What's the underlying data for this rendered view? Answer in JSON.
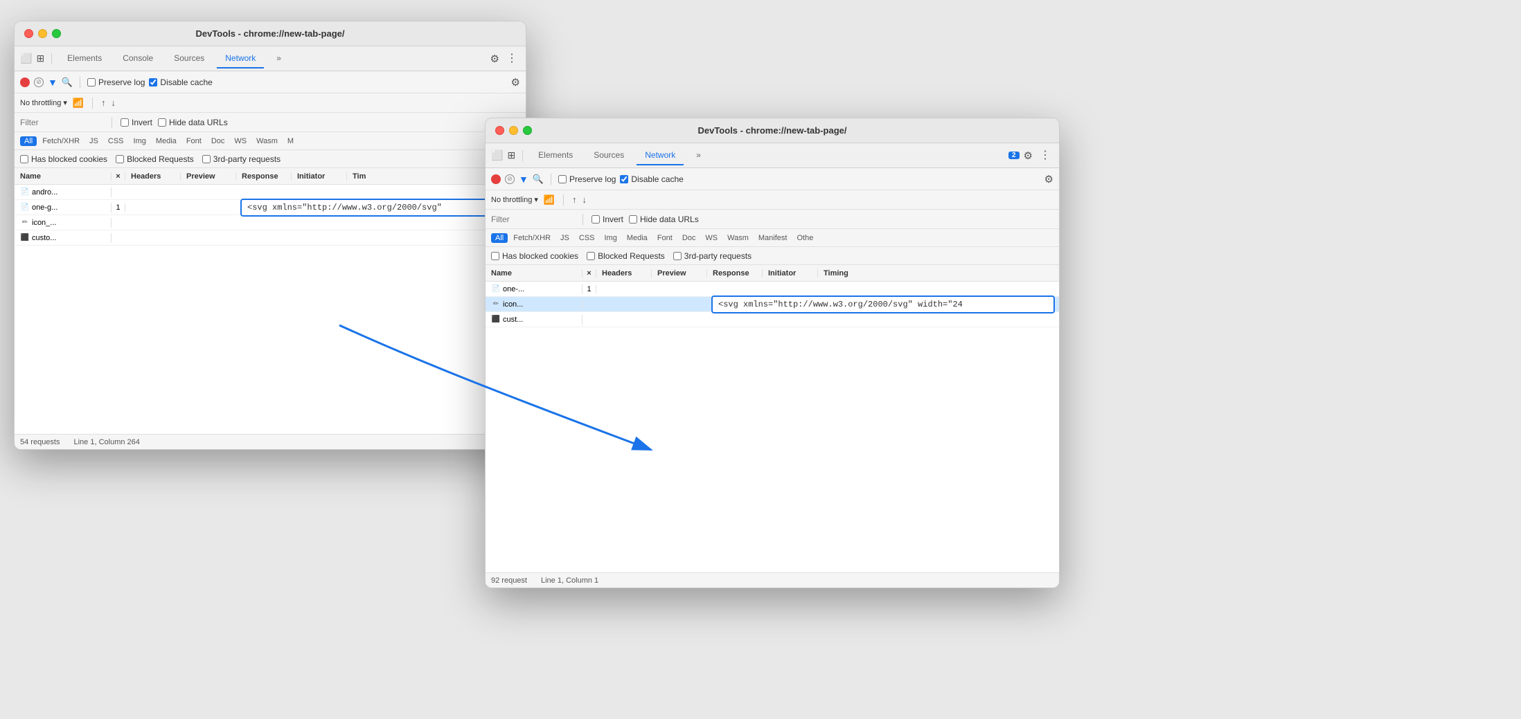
{
  "window1": {
    "title": "DevTools - chrome://new-tab-page/",
    "tabs": [
      "Elements",
      "Console",
      "Sources",
      "Network",
      "»"
    ],
    "active_tab": "Network",
    "network_controls": {
      "preserve_log": "Preserve log",
      "disable_cache": "Disable cache"
    },
    "throttling": "No throttling",
    "filter_placeholder": "Filter",
    "filter_options": [
      "Invert",
      "Hide data URLs"
    ],
    "type_filters": [
      "All",
      "Fetch/XHR",
      "JS",
      "CSS",
      "Img",
      "Media",
      "Font",
      "Doc",
      "WS",
      "Wasm",
      "M"
    ],
    "active_type": "All",
    "checkboxes": [
      "Has blocked cookies",
      "Blocked Requests",
      "3rd-party requests"
    ],
    "table": {
      "columns": [
        "Name",
        "×",
        "Headers",
        "Preview",
        "Response",
        "Initiator",
        "Tim"
      ],
      "rows": [
        {
          "icon": "doc",
          "name": "andro...",
          "num": "",
          "selected": false
        },
        {
          "icon": "doc",
          "name": "one-g...",
          "num": "1",
          "selected": false
        },
        {
          "icon": "pencil",
          "name": "icon_...",
          "num": "",
          "selected": false
        },
        {
          "icon": "js",
          "name": "custo...",
          "num": "",
          "selected": false
        }
      ]
    },
    "response_preview": "<svg xmlns=\"http://www.w3.org/2000/svg\"",
    "status": {
      "requests": "54 requests",
      "position": "Line 1, Column 264"
    }
  },
  "window2": {
    "title": "DevTools - chrome://new-tab-page/",
    "tabs": [
      "Elements",
      "Sources",
      "Network",
      "»"
    ],
    "active_tab": "Network",
    "badge": "2",
    "network_controls": {
      "preserve_log": "Preserve log",
      "disable_cache": "Disable cache"
    },
    "throttling": "No throttling",
    "filter_placeholder": "Filter",
    "filter_options": [
      "Invert",
      "Hide data URLs"
    ],
    "type_filters": [
      "All",
      "Fetch/XHR",
      "JS",
      "CSS",
      "Img",
      "Media",
      "Font",
      "Doc",
      "WS",
      "Wasm",
      "Manifest",
      "Othe"
    ],
    "active_type": "All",
    "checkboxes": [
      "Has blocked cookies",
      "Blocked Requests",
      "3rd-party requests"
    ],
    "table": {
      "columns": [
        "Name",
        "×",
        "Headers",
        "Preview",
        "Response",
        "Initiator",
        "Timing"
      ],
      "rows": [
        {
          "icon": "doc",
          "name": "one-...",
          "num": "1",
          "selected": false
        },
        {
          "icon": "pencil",
          "name": "icon...",
          "num": "",
          "selected": true
        },
        {
          "icon": "js",
          "name": "cust...",
          "num": "",
          "selected": false
        }
      ]
    },
    "response_preview": "<svg xmlns=\"http://www.w3.org/2000/svg\" width=\"24",
    "status": {
      "requests": "92 request",
      "position": "Line 1, Column 1"
    }
  },
  "icons": {
    "cursor": "⬜",
    "elements": "📄",
    "record_stop": "⏺",
    "block": "🚫",
    "filter": "▼",
    "search": "🔍",
    "gear": "⚙",
    "more": "⋮",
    "upload": "↑",
    "download": "↓",
    "wifi": "📶",
    "chevron": "▾"
  }
}
